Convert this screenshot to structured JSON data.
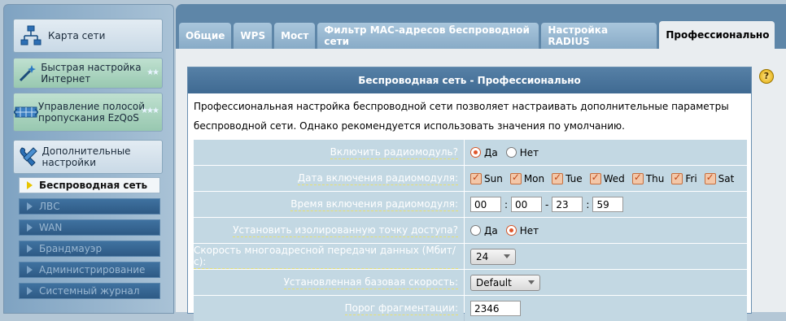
{
  "sidebar": {
    "tiles": [
      {
        "label": "Карта сети",
        "icon": "network-map-icon"
      },
      {
        "label": "Быстрая настройка Интернет",
        "icon": "magic-wand-icon"
      },
      {
        "label": "Управление полосой пропускания EzQoS",
        "icon": "bandwidth-icon"
      },
      {
        "label": "Дополнительные настройки",
        "icon": "tools-icon"
      }
    ],
    "items": [
      {
        "label": "Беспроводная сеть",
        "active": true
      },
      {
        "label": "ЛВС"
      },
      {
        "label": "WAN"
      },
      {
        "label": "Брандмауэр"
      },
      {
        "label": "Администрирование"
      },
      {
        "label": "Системный журнал"
      }
    ]
  },
  "tabs": [
    {
      "label": "Общие"
    },
    {
      "label": "WPS"
    },
    {
      "label": "Мост"
    },
    {
      "label": "Фильтр MAC-адресов беспроводной сети"
    },
    {
      "label": "Настройка RADIUS"
    },
    {
      "label": "Профессионально",
      "active": true
    }
  ],
  "help": {
    "label": "?"
  },
  "panel": {
    "title": "Беспроводная сеть - Профессионально",
    "description": "Профессиональная настройка беспроводной сети позволяет настраивать дополнительные параметры беспроводной сети. Однако рекомендуется использовать значения по умолчанию."
  },
  "form": {
    "radio_enable": {
      "label": "Включить радиомодуль?",
      "yes": "Да",
      "no": "Нет",
      "selected": "yes"
    },
    "radio_days": {
      "label": "Дата включения радиомодуля:",
      "days": [
        "Sun",
        "Mon",
        "Tue",
        "Wed",
        "Thu",
        "Fri",
        "Sat"
      ]
    },
    "radio_time": {
      "label": "Время включения радиомодуля:",
      "start_h": "00",
      "start_m": "00",
      "end_h": "23",
      "end_m": "59"
    },
    "isolated_ap": {
      "label": "Установить изолированную точку доступа?",
      "yes": "Да",
      "no": "Нет",
      "selected": "no"
    },
    "multicast_rate": {
      "label": "Скорость многоадресной передачи данных (Мбит/с):",
      "value": "24"
    },
    "basic_rate": {
      "label": "Установленная базовая скорость:",
      "value": "Default"
    },
    "frag_threshold": {
      "label": "Порог фрагментации:",
      "value": "2346"
    }
  },
  "colors": {
    "accent": "#e0552a",
    "header": "#4a7299",
    "label_bg": "#c3d8e3"
  }
}
